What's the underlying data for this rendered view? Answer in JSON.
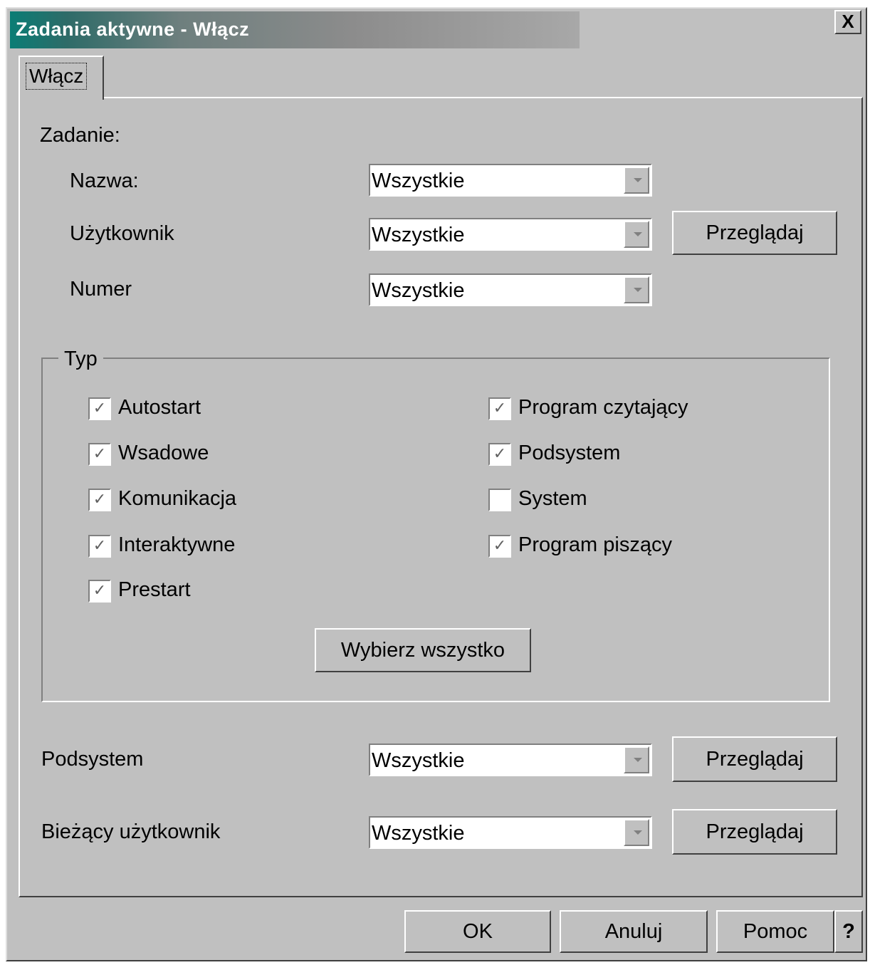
{
  "window": {
    "title": "Zadania aktywne - Włącz",
    "close_label": "X"
  },
  "tabs": [
    {
      "label": "Włącz"
    }
  ],
  "job_section": {
    "heading": "Zadanie:",
    "name_label": "Nazwa:",
    "name_value": "Wszystkie",
    "user_label": "Użytkownik",
    "user_value": "Wszystkie",
    "user_browse": "Przeglądaj",
    "number_label": "Numer",
    "number_value": "Wszystkie"
  },
  "type_group": {
    "title": "Typ",
    "left": [
      {
        "label": "Autostart",
        "checked": true
      },
      {
        "label": "Wsadowe",
        "checked": true
      },
      {
        "label": "Komunikacja",
        "checked": true
      },
      {
        "label": "Interaktywne",
        "checked": true
      },
      {
        "label": "Prestart",
        "checked": true
      }
    ],
    "right": [
      {
        "label": "Program czytający",
        "checked": true
      },
      {
        "label": "Podsystem",
        "checked": true
      },
      {
        "label": "System",
        "checked": false
      },
      {
        "label": "Program piszący",
        "checked": true
      }
    ],
    "select_all": "Wybierz wszystko"
  },
  "subsystem": {
    "label": "Podsystem",
    "value": "Wszystkie",
    "browse": "Przeglądaj"
  },
  "current_user": {
    "label": "Bieżący użytkownik",
    "value": "Wszystkie",
    "browse": "Przeglądaj"
  },
  "footer": {
    "ok": "OK",
    "cancel": "Anuluj",
    "help": "Pomoc",
    "whats_this": "?"
  }
}
